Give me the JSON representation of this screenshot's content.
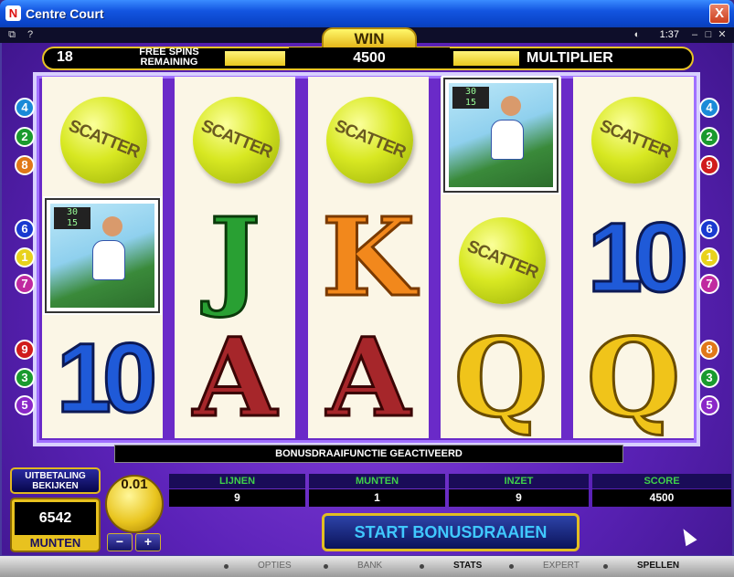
{
  "window": {
    "title": "Centre Court",
    "app_icon": "N",
    "close": "X"
  },
  "toolbar": {
    "clock": "1:37",
    "icons": [
      "window-icon",
      "help-icon",
      "sound-icon",
      "minimize-icon",
      "maximize-icon",
      "close-icon"
    ],
    "help": "?"
  },
  "info": {
    "free_spins_count": "18",
    "free_spins_label": "FREE SPINS REMAINING",
    "win_label": "WIN",
    "win_value": "4500",
    "multiplier_label": "MULTIPLIER"
  },
  "reels": [
    [
      "SCATTER",
      "player",
      "10"
    ],
    [
      "SCATTER",
      "J",
      "A"
    ],
    [
      "SCATTER",
      "K",
      "A"
    ],
    [
      "player",
      "SCATTER",
      "Q"
    ],
    [
      "SCATTER",
      "10",
      "Q"
    ]
  ],
  "scatter_text": "SCATTER",
  "player_score": "30\n15",
  "line_markers_left": [
    "4",
    "2",
    "8",
    "6",
    "1",
    "7",
    "9",
    "3",
    "5"
  ],
  "line_markers_right": [
    "4",
    "2",
    "9",
    "6",
    "1",
    "7",
    "8",
    "3",
    "5"
  ],
  "marker_colors": {
    "1": "#e8d21c",
    "2": "#1a9a2e",
    "3": "#1a9a2e",
    "4": "#1a8ad8",
    "5": "#8a28c8",
    "6": "#1a3ad0",
    "7": "#c02aa0",
    "8": "#e07818",
    "9": "#d01c1c"
  },
  "message": "BONUSDRAAIFUNCTIE GEACTIVEERD",
  "controls": {
    "payout_button": "UITBETALING BEKIJKEN",
    "credits": "6542",
    "credits_label": "MUNTEN",
    "coin_value": "0.01",
    "coin_minus": "−",
    "coin_plus": "+",
    "stats": [
      {
        "label": "LIJNEN",
        "value": "9"
      },
      {
        "label": "MUNTEN",
        "value": "1"
      },
      {
        "label": "INZET",
        "value": "9"
      },
      {
        "label": "SCORE",
        "value": "4500"
      }
    ],
    "start_button": "START BONUSDRAAIEN"
  },
  "footer": {
    "items": [
      {
        "label": "OPTIES",
        "active": false
      },
      {
        "label": "BANK",
        "active": false
      },
      {
        "label": "STATS",
        "active": true
      },
      {
        "label": "EXPERT",
        "active": false
      },
      {
        "label": "SPELLEN",
        "active": true
      }
    ]
  }
}
